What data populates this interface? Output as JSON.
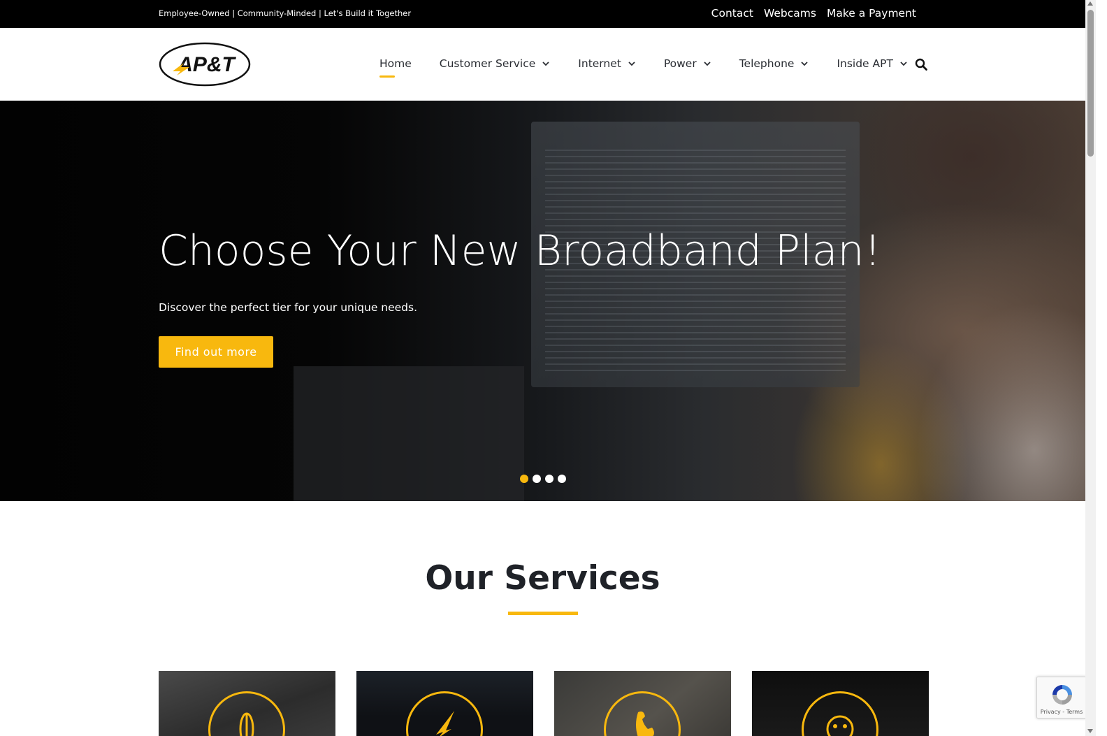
{
  "topbar": {
    "tagline": "Employee-Owned | Community-Minded | Let's Build it Together",
    "links": [
      "Contact",
      "Webcams",
      "Make a Payment"
    ]
  },
  "header": {
    "logo_text": "AP&T",
    "nav": [
      {
        "label": "Home",
        "active": true,
        "dropdown": false
      },
      {
        "label": "Customer Service",
        "active": false,
        "dropdown": true
      },
      {
        "label": "Internet",
        "active": false,
        "dropdown": true
      },
      {
        "label": "Power",
        "active": false,
        "dropdown": true
      },
      {
        "label": "Telephone",
        "active": false,
        "dropdown": true
      },
      {
        "label": "Inside APT",
        "active": false,
        "dropdown": true
      }
    ],
    "search_icon": "search-icon"
  },
  "hero": {
    "title": "Choose Your New Broadband Plan!",
    "subtitle": "Discover the perfect tier for your unique needs.",
    "cta_label": "Find out more",
    "slides_count": 4,
    "active_slide": 1
  },
  "services": {
    "title": "Our Services",
    "cards": [
      {
        "icon": "globe-icon"
      },
      {
        "icon": "lightning-icon"
      },
      {
        "icon": "telephone-icon"
      },
      {
        "icon": "support-icon"
      }
    ]
  },
  "recaptcha": {
    "links": "Privacy - Terms"
  },
  "colors": {
    "accent": "#f8b80e",
    "topbar_bg": "#000000",
    "text_dark": "#1f2228"
  }
}
